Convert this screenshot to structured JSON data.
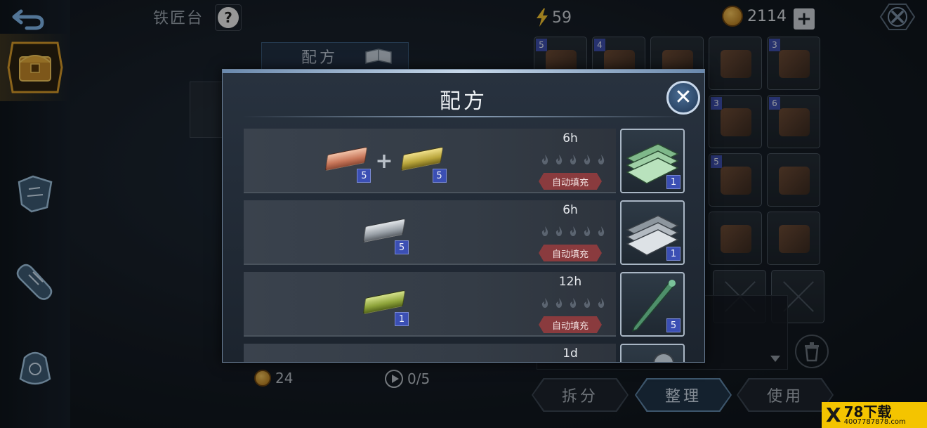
{
  "header": {
    "title": "铁匠台",
    "help": "?",
    "energy": "59",
    "coins": "2114",
    "add": "+"
  },
  "background": {
    "recipe_tab_label": "配方",
    "coin_count": "24",
    "timer": "0/5"
  },
  "inventory": {
    "cells": [
      {
        "badge": "5"
      },
      {
        "badge": "4"
      },
      {
        "badge": ""
      },
      {
        "badge": ""
      },
      {
        "badge": "3"
      },
      {
        "badge": ""
      },
      {
        "badge": ""
      },
      {
        "badge": ""
      },
      {
        "badge": "3"
      },
      {
        "badge": "6"
      },
      {
        "badge": ""
      },
      {
        "badge": ""
      },
      {
        "badge": ""
      },
      {
        "badge": "5"
      },
      {
        "badge": ""
      },
      {
        "badge": ""
      },
      {
        "badge": ""
      },
      {
        "badge": ""
      },
      {
        "badge": ""
      },
      {
        "badge": ""
      }
    ]
  },
  "actions": {
    "split": "拆分",
    "sort": "整理",
    "use": "使用"
  },
  "modal": {
    "title": "配方",
    "close": "✕",
    "recipes": [
      {
        "time": "6h",
        "autofill": "自动填充",
        "ingredients": [
          {
            "type": "copper-ingot",
            "qty": "5"
          },
          {
            "type": "brass-ingot",
            "qty": "5"
          }
        ],
        "result": {
          "type": "green-plates",
          "qty": "1"
        }
      },
      {
        "time": "6h",
        "autofill": "自动填充",
        "ingredients": [
          {
            "type": "iron-ingot",
            "qty": "5"
          }
        ],
        "result": {
          "type": "iron-plates",
          "qty": "1"
        }
      },
      {
        "time": "12h",
        "autofill": "自动填充",
        "ingredients": [
          {
            "type": "green-ingot",
            "qty": "1"
          }
        ],
        "result": {
          "type": "green-spike",
          "qty": "5"
        }
      },
      {
        "time": "1d",
        "autofill": "",
        "ingredients": [],
        "result": {
          "type": "round-item",
          "qty": ""
        }
      }
    ]
  },
  "watermark": {
    "brand": "78下载",
    "url": "4007787878.com"
  },
  "colors": {
    "accent_blue": "#3b4fb4",
    "autofill_red": "#8a3b3e",
    "gold": "#f3c25a"
  }
}
